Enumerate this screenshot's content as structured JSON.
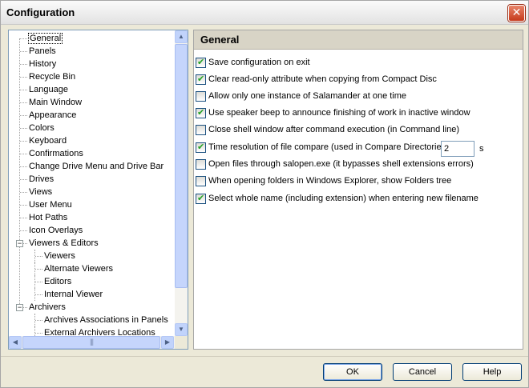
{
  "window": {
    "title": "Configuration"
  },
  "tree": {
    "items": [
      {
        "label": "General",
        "selected": true
      },
      {
        "label": "Panels"
      },
      {
        "label": "History"
      },
      {
        "label": "Recycle Bin"
      },
      {
        "label": "Language"
      },
      {
        "label": "Main Window"
      },
      {
        "label": "Appearance"
      },
      {
        "label": "Colors"
      },
      {
        "label": "Keyboard"
      },
      {
        "label": "Confirmations"
      },
      {
        "label": "Change Drive Menu and Drive Bar"
      },
      {
        "label": "Drives"
      },
      {
        "label": "Views"
      },
      {
        "label": "User Menu"
      },
      {
        "label": "Hot Paths"
      },
      {
        "label": "Icon Overlays"
      },
      {
        "label": "Viewers & Editors",
        "expander": "−"
      },
      {
        "label": "Viewers",
        "level": 2
      },
      {
        "label": "Alternate Viewers",
        "level": 2
      },
      {
        "label": "Editors",
        "level": 2
      },
      {
        "label": "Internal Viewer",
        "level": 2
      },
      {
        "label": "Archivers",
        "expander": "−"
      },
      {
        "label": "Archives Associations in Panels",
        "level": 2
      },
      {
        "label": "External Archivers Locations",
        "level": 2
      }
    ]
  },
  "panel": {
    "title": "General",
    "options": [
      {
        "label": "Save configuration on exit",
        "checked": true
      },
      {
        "label": "Clear read-only attribute when copying from Compact Disc",
        "checked": true
      },
      {
        "label": "Allow only one instance of Salamander at one time",
        "checked": false
      },
      {
        "label": "Use speaker beep to announce finishing of work in inactive window",
        "checked": true
      },
      {
        "label": "Close shell window after command execution (in Command line)",
        "checked": false
      },
      {
        "label": "Time resolution of file compare (used in Compare Directories)",
        "checked": true
      },
      {
        "label": "Open files through salopen.exe (it bypasses shell extensions errors)",
        "checked": false
      },
      {
        "label": "When opening folders in Windows Explorer, show Folders tree",
        "checked": false
      },
      {
        "label": "Select whole name (including extension) when entering new filename",
        "checked": true
      }
    ],
    "time_resolution_value": "2",
    "time_resolution_unit": "s"
  },
  "buttons": {
    "ok": "OK",
    "cancel": "Cancel",
    "help": "Help"
  },
  "icons": {
    "close": "close-icon",
    "scroll_up": "arrow-up-icon",
    "scroll_down": "arrow-down-icon",
    "scroll_left": "arrow-left-icon",
    "scroll_right": "arrow-right-icon"
  },
  "colors": {
    "close_button": "#c63a1c",
    "checkmark": "#21a121",
    "panel_header": "#d8d4c6"
  }
}
